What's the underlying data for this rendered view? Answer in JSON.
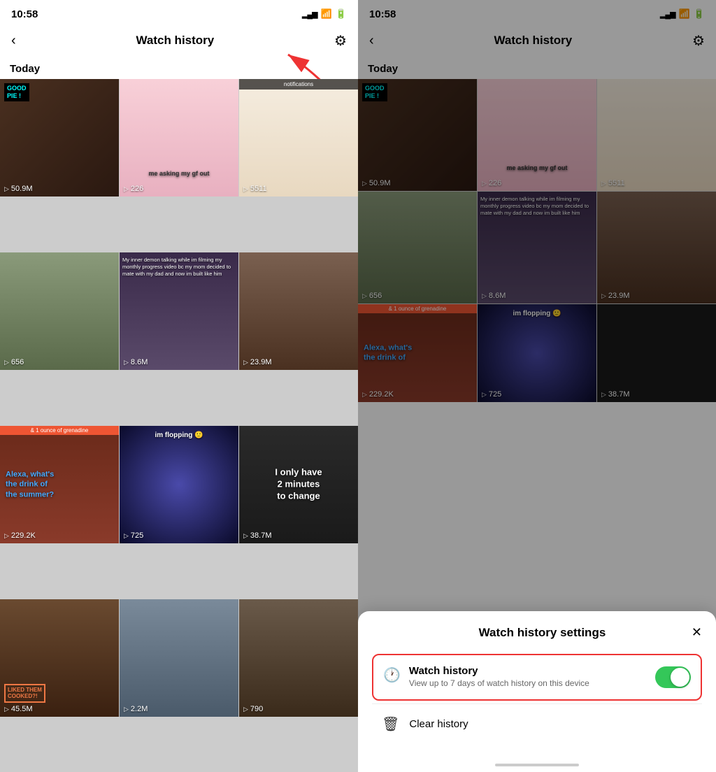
{
  "left_panel": {
    "status_time": "10:58",
    "nav_title": "Watch history",
    "section_label": "Today",
    "videos": [
      {
        "id": 1,
        "count": "50.9M",
        "color": "dark",
        "badge": "GOOD\nPIE !"
      },
      {
        "id": 2,
        "count": "226",
        "color": "anime",
        "caption": "me asking my gf out"
      },
      {
        "id": 3,
        "count": "5511",
        "color": "draw",
        "notif": "notifications"
      },
      {
        "id": 4,
        "count": "656",
        "color": "dog"
      },
      {
        "id": 5,
        "count": "8.6M",
        "color": "hall",
        "caption": "My inner demon talking while im filming..."
      },
      {
        "id": 6,
        "count": "23.9M",
        "color": "dance"
      },
      {
        "id": 7,
        "count": "229.2K",
        "color": "red",
        "alexa": "Alexa, what's the drink of the summer?"
      },
      {
        "id": 8,
        "count": "725",
        "color": "cube",
        "caption": "im flopping 🙂"
      },
      {
        "id": 9,
        "count": "38.7M",
        "color": "black",
        "only": "I only have 2 minutes to change"
      },
      {
        "id": 10,
        "count": "45.5M",
        "color": "chef",
        "badge_red": "LIKED THEM COOKED?!"
      },
      {
        "id": 11,
        "count": "2.2M",
        "color": "ellen"
      },
      {
        "id": 12,
        "count": "790",
        "color": "cow"
      }
    ]
  },
  "right_panel": {
    "status_time": "10:58",
    "nav_title": "Watch history",
    "section_label": "Today",
    "settings_sheet": {
      "title": "Watch history settings",
      "close_label": "✕",
      "toggle_row": {
        "label": "Watch history",
        "description": "View up to 7 days of watch history on this device",
        "enabled": true
      },
      "clear_row": {
        "label": "Clear history"
      }
    }
  },
  "arrow": {
    "visible": true
  }
}
